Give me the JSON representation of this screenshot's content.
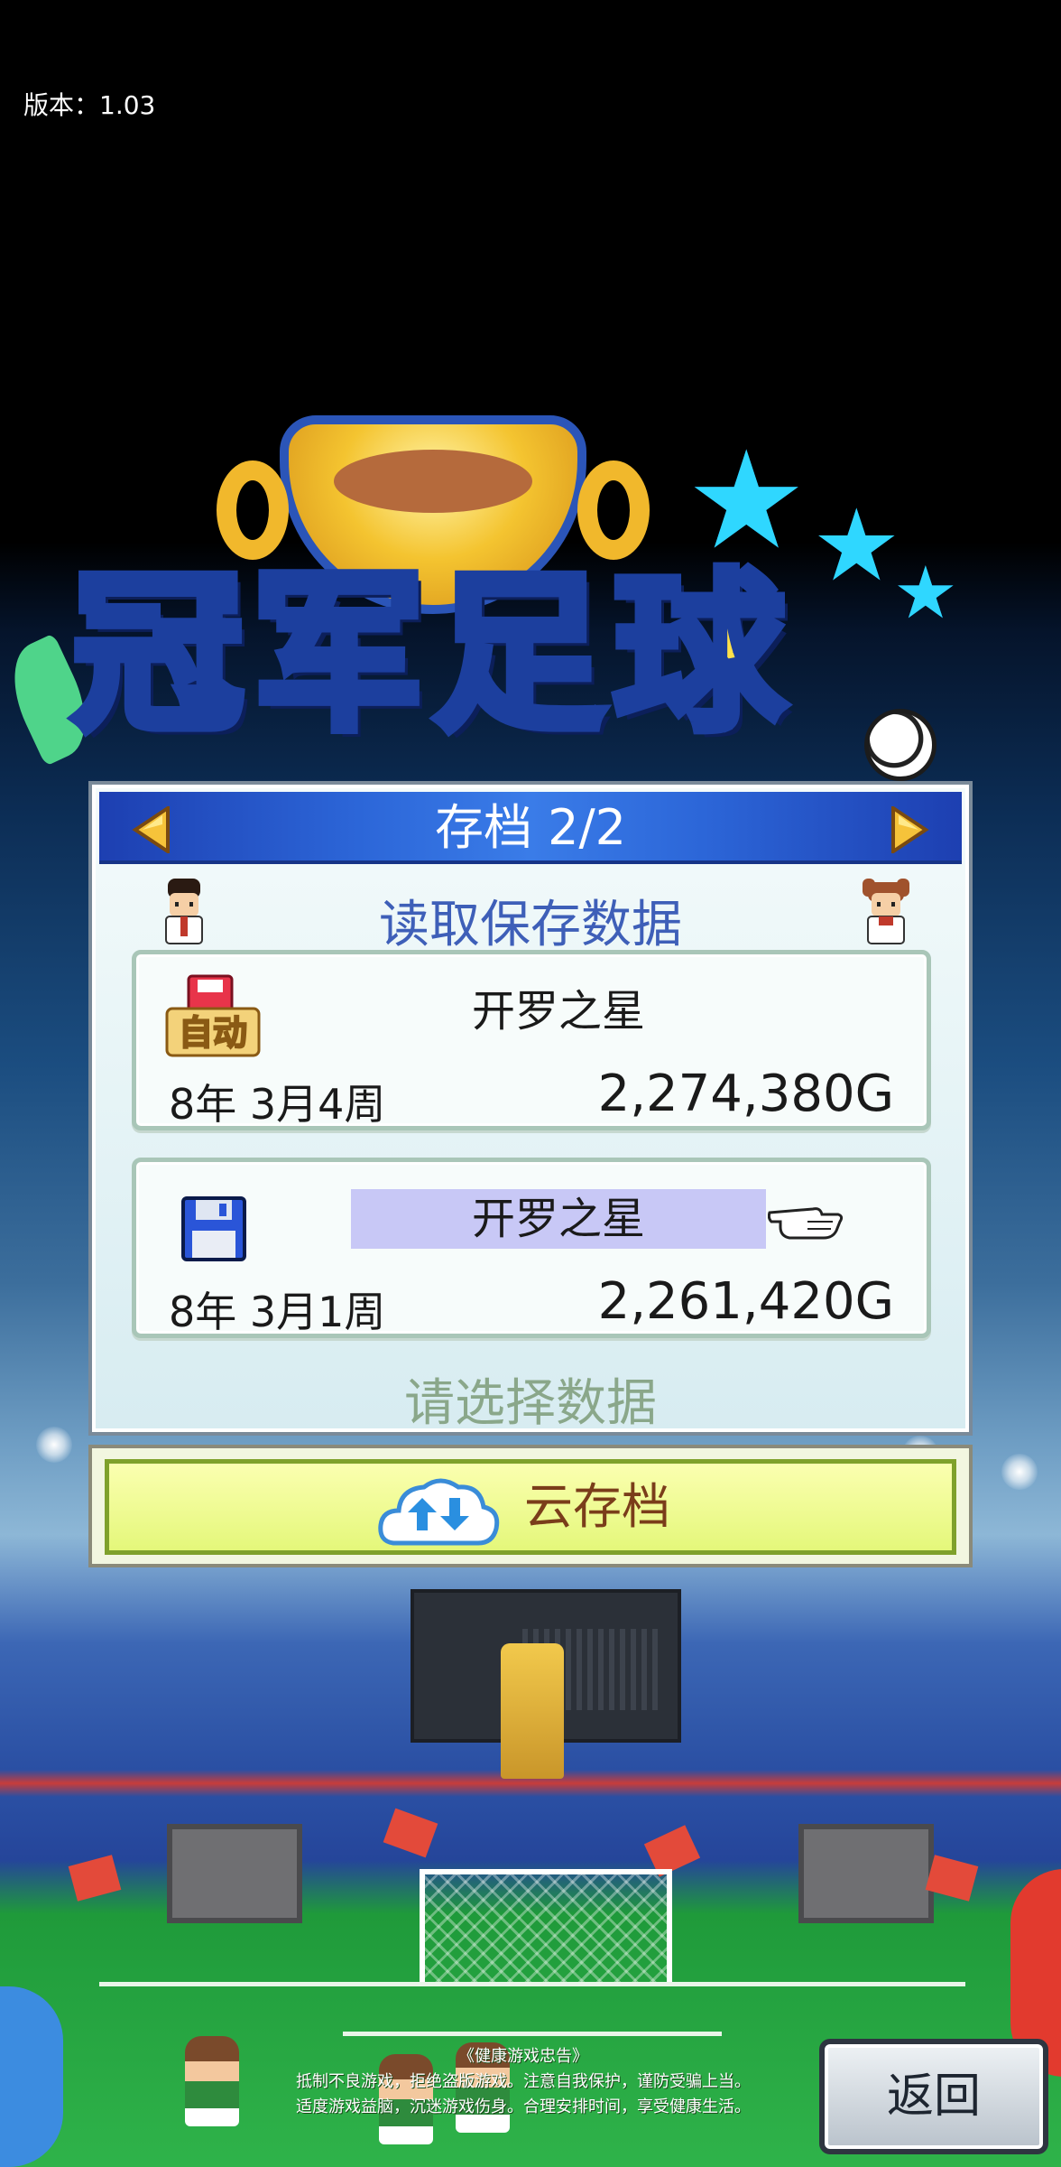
{
  "version_label": "版本：1.03",
  "logo_text": "冠军足球",
  "panel": {
    "title": "存档 2/2",
    "subtitle": "读取保存数据",
    "prev_icon": "triangle-left-icon",
    "next_icon": "triangle-right-icon",
    "saves": [
      {
        "icon": "auto-save-icon",
        "icon_badge": "自动",
        "name": "开罗之星",
        "date": "8年 3月4周",
        "money": "2,274,380G",
        "selected": false
      },
      {
        "icon": "floppy-disk-icon",
        "name": "开罗之星",
        "date": "8年 3月1周",
        "money": "2,261,420G",
        "selected": true
      }
    ],
    "prompt": "请选择数据"
  },
  "cloud_save": {
    "label": "云存档",
    "icon": "cloud-transfer-icon"
  },
  "health_notice": {
    "title": "《健康游戏忠告》",
    "line1": "抵制不良游戏，拒绝盗版游戏。注意自我保护，谨防受骗上当。",
    "line2": "适度游戏益脑，沉迷游戏伤身。合理安排时间，享受健康生活。"
  },
  "back_button": "返回",
  "colors": {
    "header_blue": "#2c66d8",
    "subtitle_blue": "#3e5fb8",
    "prompt_green": "#8aa78a",
    "cloud_green": "#e4f77a",
    "selected_highlight": "#c8c8f6"
  }
}
